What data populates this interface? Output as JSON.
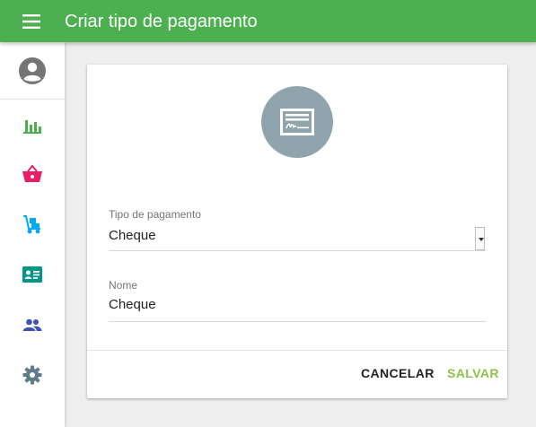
{
  "appbar": {
    "title": "Criar tipo de pagamento",
    "menu_icon": "menu-icon",
    "color": "#4caf50"
  },
  "sidebar": {
    "avatar_icon": "account-circle-icon",
    "items": [
      {
        "icon": "bar-chart-icon",
        "color": "#4caf50"
      },
      {
        "icon": "shopping-basket-icon",
        "color": "#e91e63"
      },
      {
        "icon": "hand-truck-icon",
        "color": "#03a9f4"
      },
      {
        "icon": "id-card-icon",
        "color": "#009688"
      },
      {
        "icon": "people-icon",
        "color": "#3f51b5"
      },
      {
        "icon": "settings-gear-icon",
        "color": "#607d8b"
      }
    ]
  },
  "form": {
    "header_icon": "check-document-icon",
    "header_icon_bg": "#90a4ae",
    "payment_type": {
      "label": "Tipo de pagamento",
      "value": "Cheque"
    },
    "name": {
      "label": "Nome",
      "value": "Cheque"
    },
    "actions": {
      "cancel_label": "CANCELAR",
      "save_label": "SALVAR",
      "save_color": "#8bc34a"
    }
  }
}
